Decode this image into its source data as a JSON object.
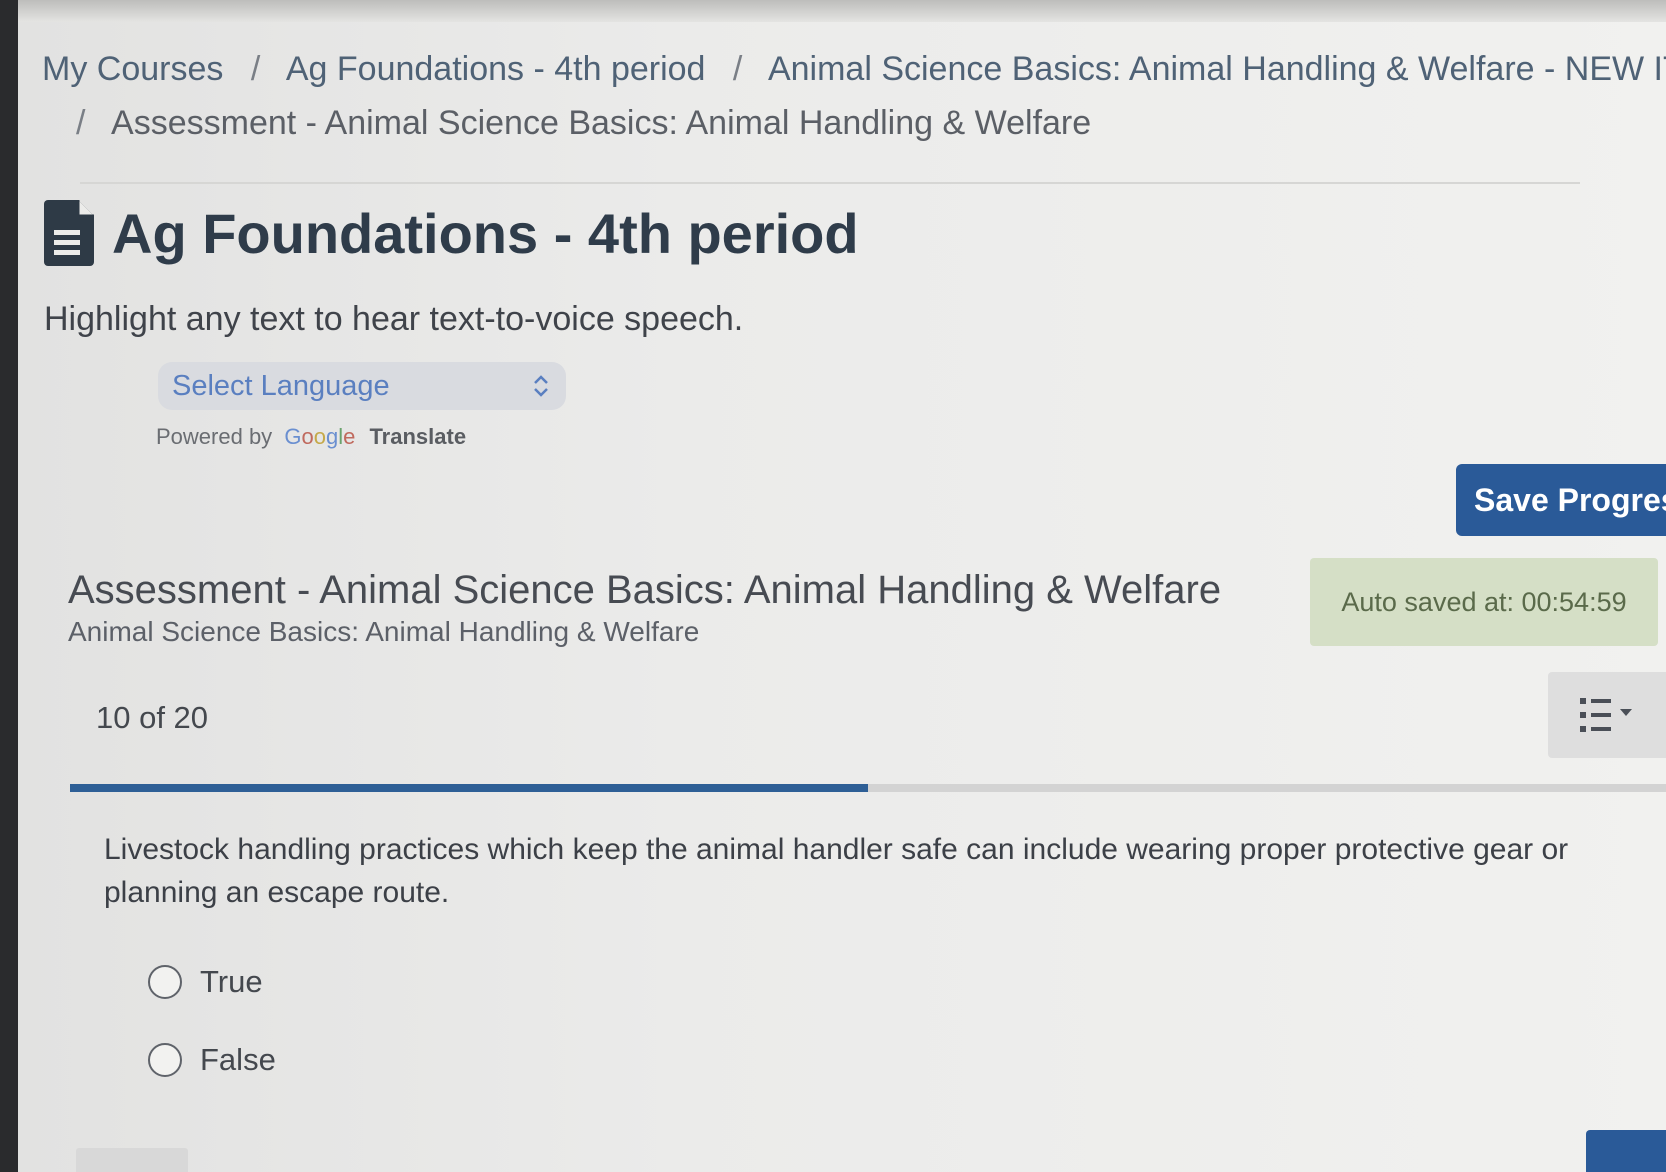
{
  "breadcrumb": {
    "items": [
      "My Courses",
      "Ag Foundations - 4th period",
      "Animal Science Basics: Animal Handling & Welfare - NEW ITEM",
      "Assessment - Animal Science Basics: Animal Handling & Welfare"
    ],
    "separator": "/"
  },
  "header": {
    "title": "Ag Foundations - 4th period",
    "icon": "document-icon"
  },
  "tts_hint": "Highlight any text to hear text-to-voice speech.",
  "translate": {
    "select_label": "Select Language",
    "powered_by": "Powered by",
    "google": [
      "G",
      "o",
      "o",
      "g",
      "l",
      "e"
    ],
    "translate_label": "Translate"
  },
  "save_button": "Save Progress",
  "assessment": {
    "title": "Assessment - Animal Science Basics: Animal Handling & Welfare",
    "subtitle": "Animal Science Basics: Animal Handling & Welfare",
    "autosave": "Auto saved at: 00:54:59",
    "counter": "10 of 20",
    "progress_fraction": 0.5,
    "question": "Livestock handling practices which keep the animal handler safe can include wearing proper protective gear or planning an escape route.",
    "options": [
      "True",
      "False"
    ]
  },
  "colors": {
    "accent": "#2a5a98",
    "progress": "#2e5f96",
    "autosave_bg": "#d5dfc6"
  }
}
